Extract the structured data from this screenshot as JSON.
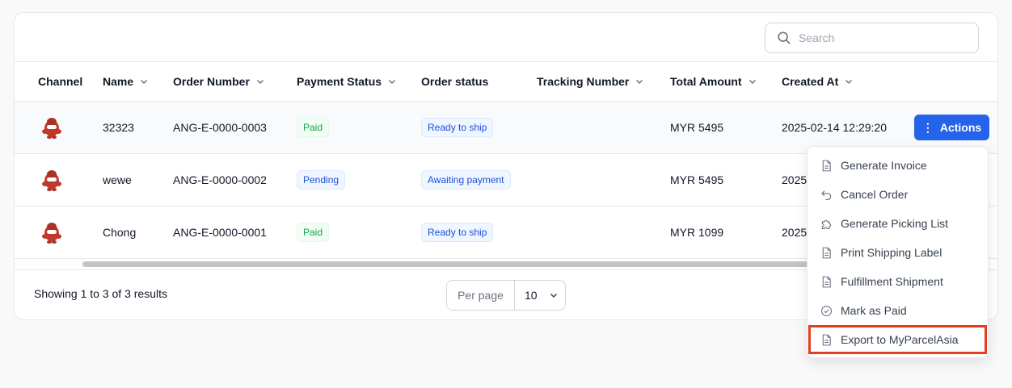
{
  "search": {
    "placeholder": "Search"
  },
  "columns": {
    "channel": "Channel",
    "name": "Name",
    "order_number": "Order Number",
    "payment_status": "Payment Status",
    "order_status": "Order status",
    "tracking_number": "Tracking Number",
    "total_amount": "Total Amount",
    "created_at": "Created At"
  },
  "rows": [
    {
      "name": "32323",
      "order_number": "ANG-E-0000-0003",
      "payment_status": "Paid",
      "order_status": "Ready to ship",
      "tracking": "",
      "total": "MYR 5495",
      "created": "2025-02-14 12:29:20"
    },
    {
      "name": "wewe",
      "order_number": "ANG-E-0000-0002",
      "payment_status": "Pending",
      "order_status": "Awaiting payment",
      "tracking": "",
      "total": "MYR 5495",
      "created": "2025"
    },
    {
      "name": "Chong",
      "order_number": "ANG-E-0000-0001",
      "payment_status": "Paid",
      "order_status": "Ready to ship",
      "tracking": "",
      "total": "MYR 1099",
      "created": "2025"
    }
  ],
  "actions_button": {
    "label": "Actions"
  },
  "actions_menu": [
    {
      "label": "Generate Invoice",
      "icon": "document-icon"
    },
    {
      "label": "Cancel Order",
      "icon": "undo-arrow-icon"
    },
    {
      "label": "Generate Picking List",
      "icon": "puzzle-icon"
    },
    {
      "label": "Print Shipping Label",
      "icon": "document-icon"
    },
    {
      "label": "Fulfillment Shipment",
      "icon": "document-icon"
    },
    {
      "label": "Mark as Paid",
      "icon": "check-circle-icon"
    },
    {
      "label": "Export to MyParcelAsia",
      "icon": "document-icon",
      "highlighted": true
    }
  ],
  "pagination": {
    "summary": "Showing 1 to 3 of 3 results",
    "per_page_label": "Per page",
    "per_page_value": "10"
  },
  "colors": {
    "primary": "#2563eb",
    "highlight": "#e53e1f",
    "paid": "#16a34a",
    "status_blue": "#1d4ed8"
  }
}
